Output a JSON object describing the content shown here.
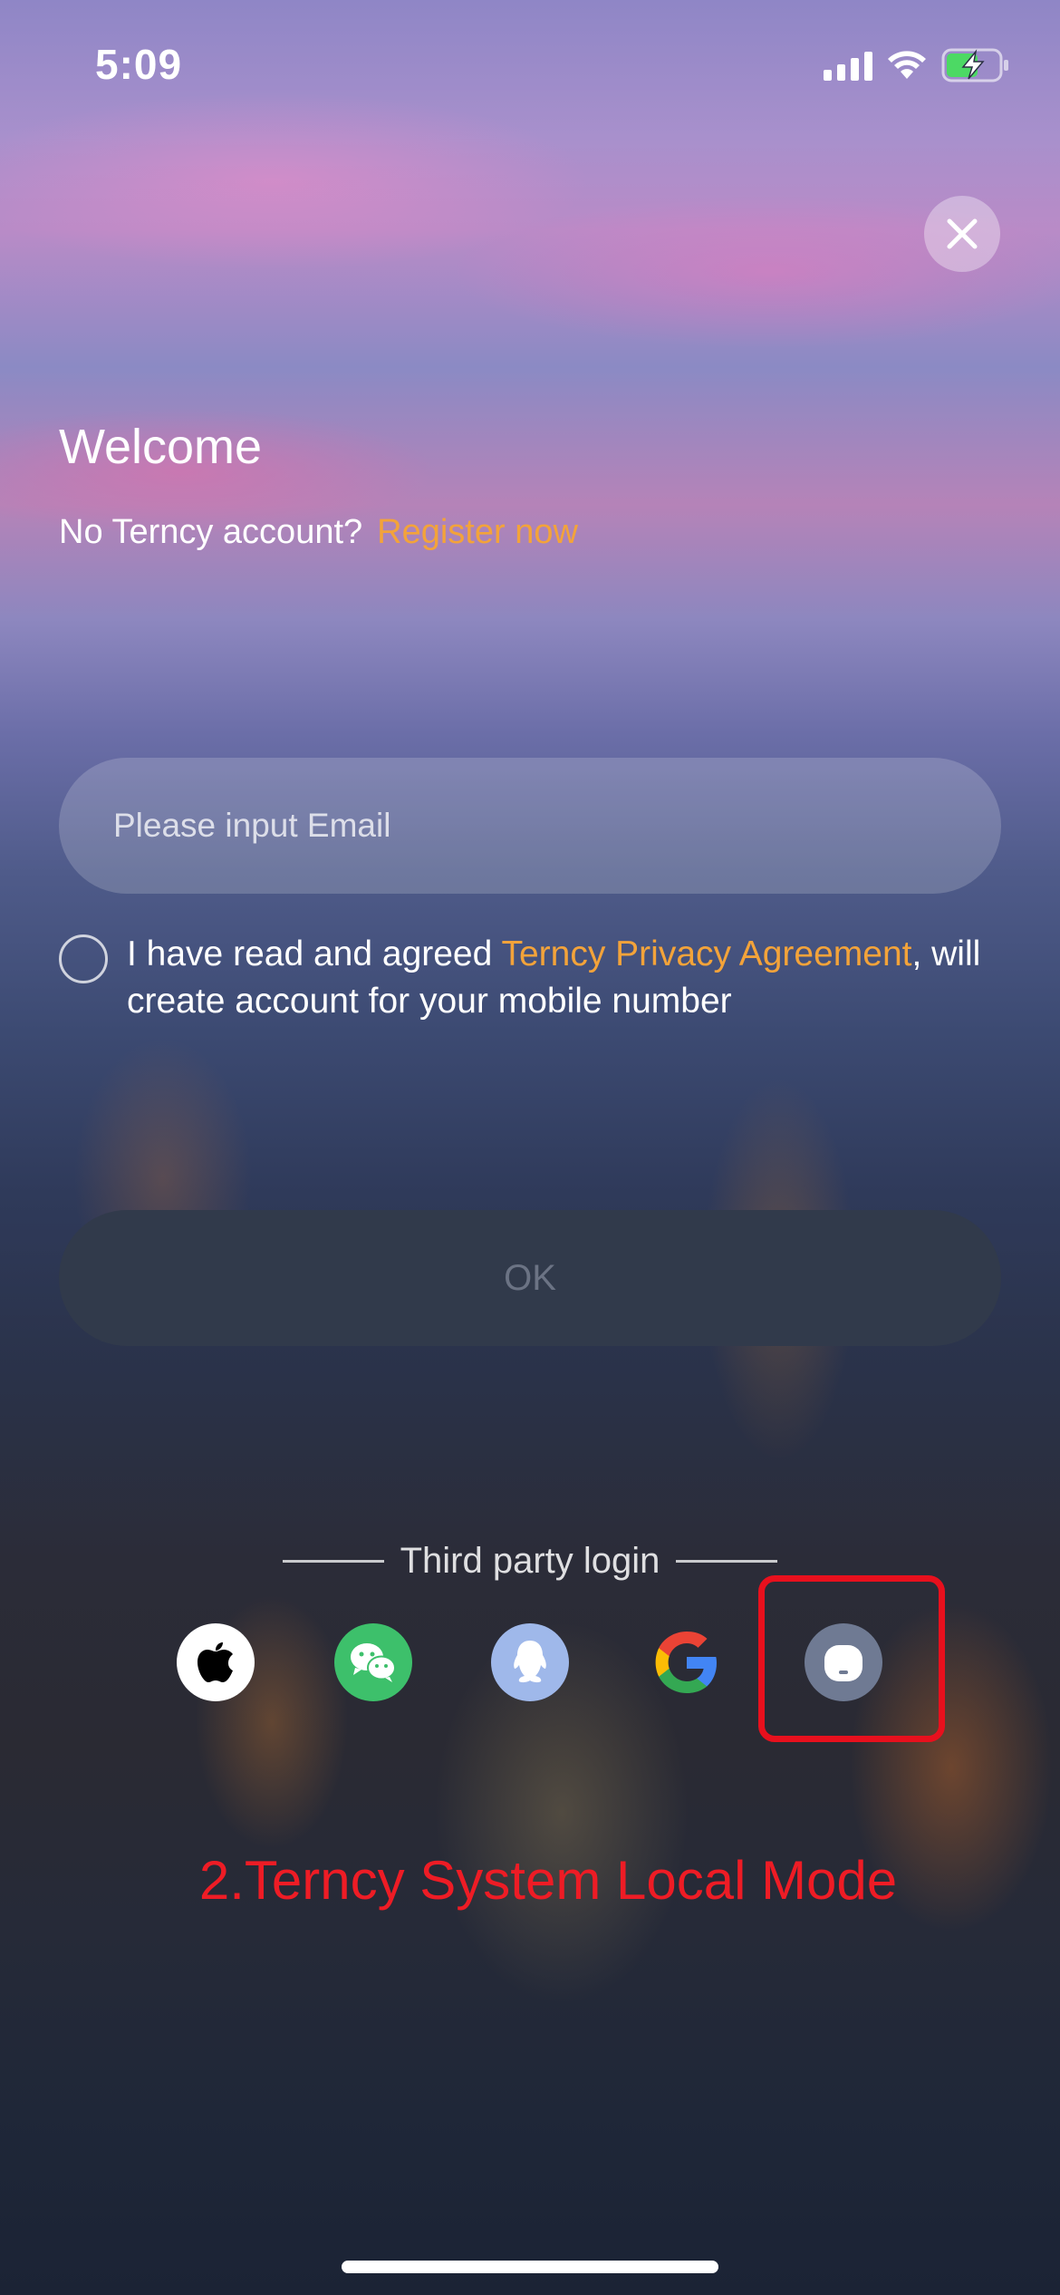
{
  "status_bar": {
    "time": "5:09"
  },
  "welcome": {
    "title": "Welcome",
    "no_account_text": "No Terncy account?",
    "register_link": "Register now"
  },
  "email": {
    "placeholder": "Please input Email",
    "value": ""
  },
  "agreement": {
    "checked": false,
    "text_before": "I have read and agreed ",
    "link": "Terncy Privacy Agreement",
    "text_after": ", will create account for your mobile number"
  },
  "ok_button": {
    "label": "OK"
  },
  "third_party": {
    "label": "Third party login",
    "providers": [
      "apple-icon",
      "wechat-icon",
      "qq-icon",
      "google-icon",
      "terncy-local-icon"
    ]
  },
  "annotation": {
    "text": "2.Terncy System Local Mode",
    "color": "#ee1c25"
  },
  "colors": {
    "accent": "#f3a33a",
    "ok_bg": "#313a4b",
    "highlight": "#e8101d"
  }
}
